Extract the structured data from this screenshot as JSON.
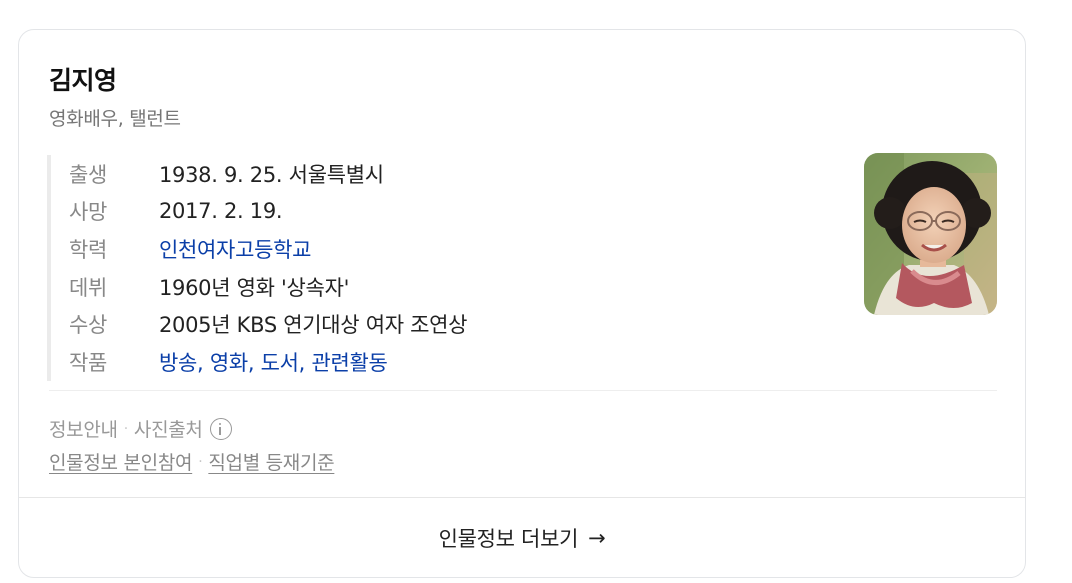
{
  "profile": {
    "name": "김지영",
    "job": "영화배우, 탤런트"
  },
  "info": [
    {
      "label": "출생",
      "value": "1938. 9. 25. 서울특별시"
    },
    {
      "label": "사망",
      "value": "2017. 2. 19."
    },
    {
      "label": "학력",
      "link": "인천여자고등학교"
    },
    {
      "label": "데뷔",
      "value": "1960년 영화 '상속자'"
    },
    {
      "label": "수상",
      "value": "2005년 KBS 연기대상 여자 조연상"
    },
    {
      "label": "작품",
      "links": [
        "방송",
        "영화",
        "도서",
        "관련활동"
      ]
    }
  ],
  "footer": {
    "info_guide": "정보안내",
    "photo_source": "사진출처",
    "self_participation": "인물정보 본인참여",
    "job_criteria": "직업별 등재기준"
  },
  "more_button": {
    "label": "인물정보 더보기",
    "arrow": "→"
  },
  "colors": {
    "link": "#0b3fa8",
    "label": "#888888",
    "border": "#e3e5e8"
  }
}
